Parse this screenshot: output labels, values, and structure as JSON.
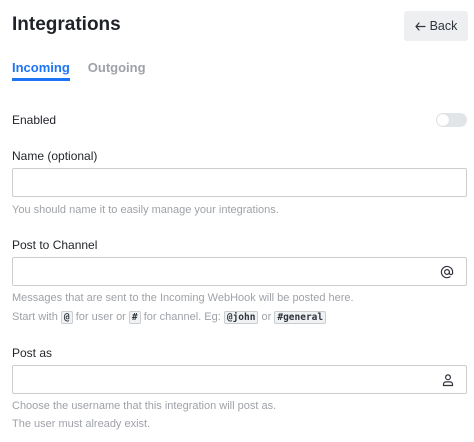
{
  "header": {
    "title": "Integrations",
    "back_label": "Back"
  },
  "tabs": [
    {
      "label": "Incoming",
      "active": true
    },
    {
      "label": "Outgoing",
      "active": false
    }
  ],
  "enabled": {
    "label": "Enabled",
    "value": false
  },
  "name_field": {
    "label": "Name (optional)",
    "value": "",
    "hint": "You should name it to easily manage your integrations."
  },
  "channel_field": {
    "label": "Post to Channel",
    "value": "",
    "icon": "at-icon",
    "hint_line1": "Messages that are sent to the Incoming WebHook will be posted here.",
    "hint_start": "Start with",
    "code_at": "@",
    "hint_user": "for user or",
    "code_hash": "#",
    "hint_channel": "for channel. Eg:",
    "code_john": "@john",
    "hint_or": "or",
    "code_general": "#general"
  },
  "post_as_field": {
    "label": "Post as",
    "value": "",
    "icon": "user-icon",
    "hint_line1": "Choose the username that this integration will post as.",
    "hint_line2": "The user must already exist."
  },
  "colors": {
    "accent": "#1d74f5",
    "muted": "#9ea2a8",
    "border": "#cbced1"
  }
}
